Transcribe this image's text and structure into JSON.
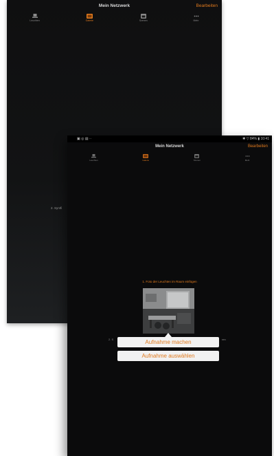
{
  "back_screen": {
    "title": "Mein Netzwerk",
    "edit_label": "Bearbeiten",
    "tabs": [
      {
        "label": "Leuchten",
        "icon": "lamp-icon",
        "active": false
      },
      {
        "label": "Galerie",
        "icon": "gallery-icon",
        "active": true
      },
      {
        "label": "Szenen",
        "icon": "scenes-icon",
        "active": false
      },
      {
        "label": "Mehr",
        "icon": "more-icon",
        "active": false
      }
    ],
    "step2_partial": "2. Syntfi"
  },
  "front_screen": {
    "status_left": "▣ ◎ ▤  ··",
    "status_right": "✱ ▽ 84% ▮ 10:41",
    "title": "Mein Netzwerk",
    "edit_label": "Bearbeiten",
    "tabs": [
      {
        "label": "Leuchten",
        "icon": "lamp-icon",
        "active": false
      },
      {
        "label": "Galerie",
        "icon": "gallery-icon",
        "active": true
      },
      {
        "label": "Szenen",
        "icon": "scenes-icon",
        "active": false
      },
      {
        "label": "Mehr",
        "icon": "more-icon",
        "active": false
      }
    ],
    "step1": "1. Foto der Leuchten im Raum einfügen",
    "step2_left": "2. S",
    "step2_right": "ren",
    "popup": {
      "take_photo": "Aufnahme machen",
      "choose_photo": "Aufnahme auswählen"
    }
  },
  "colors": {
    "accent": "#e07a1e",
    "background": "#0b0b0c"
  }
}
